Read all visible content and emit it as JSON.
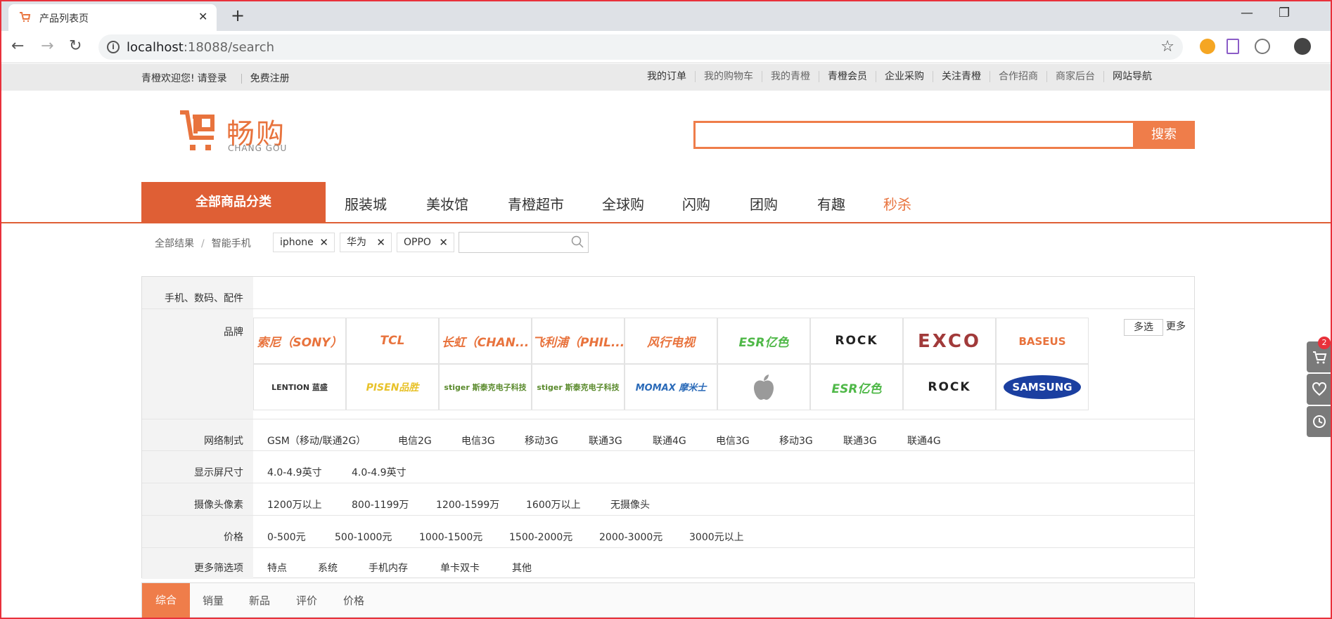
{
  "browser": {
    "tab_title": "产品列表页",
    "url_host": "localhost",
    "url_rest": ":18088/search"
  },
  "topbar": {
    "welcome": "青橙欢迎您!",
    "login": "请登录",
    "register": "免费注册",
    "links": [
      "我的订单",
      "我的购物车",
      "我的青橙",
      "青橙会员",
      "企业采购",
      "关注青橙",
      "合作招商",
      "商家后台",
      "网站导航"
    ]
  },
  "logo": {
    "name": "畅购",
    "sub": "CHANG GOU"
  },
  "search": {
    "button": "搜索",
    "value": ""
  },
  "nav": {
    "all": "全部商品分类",
    "links": [
      "服装城",
      "美妆馆",
      "青橙超市",
      "全球购",
      "闪购",
      "团购",
      "有趣",
      "秒杀"
    ]
  },
  "breadcrumb": {
    "root": "全部结果",
    "current": "智能手机",
    "tags": [
      "iphone",
      "华为",
      "OPPO"
    ]
  },
  "filters": {
    "category": "手机、数码、配件",
    "brand_label": "品牌",
    "brands_row1": [
      "索尼（SONY）",
      "TCL",
      "长虹（CHAN...",
      "飞利浦（PHIL...",
      "风行电视",
      "ESR亿色",
      "ROCK",
      "EXCO",
      "BASEUS"
    ],
    "brands_row2": [
      "LENTION 蓝盛",
      "PISEN品胜",
      "stiger 斯泰克电子科技",
      "stiger 斯泰克电子科技",
      "MOMAX 摩米士",
      "",
      "ESR亿色",
      "ROCK",
      "SAMSUNG"
    ],
    "multi": "多选",
    "more": "更多",
    "rows": [
      {
        "label": "网络制式",
        "options": [
          "GSM（移动/联通2G）",
          "电信2G",
          "电信3G",
          "移动3G",
          "联通3G",
          "联通4G",
          "电信3G",
          "移动3G",
          "联通3G",
          "联通4G"
        ]
      },
      {
        "label": "显示屏尺寸",
        "options": [
          "4.0-4.9英寸",
          "4.0-4.9英寸"
        ]
      },
      {
        "label": "摄像头像素",
        "options": [
          "1200万以上",
          "800-1199万",
          "1200-1599万",
          "1600万以上",
          "无摄像头"
        ]
      },
      {
        "label": "价格",
        "options": [
          "0-500元",
          "500-1000元",
          "1000-1500元",
          "1500-2000元",
          "2000-3000元",
          "3000元以上"
        ]
      },
      {
        "label": "更多筛选项",
        "options": [
          "特点",
          "系统",
          "手机内存",
          "单卡双卡",
          "其他"
        ]
      }
    ]
  },
  "sort": {
    "items": [
      "综合",
      "销量",
      "新品",
      "评价",
      "价格"
    ]
  },
  "float": {
    "cart_count": "2"
  },
  "colors": {
    "accent": "#ef7d4a",
    "nav_dark": "#df5f35",
    "red": "#e8313b"
  }
}
